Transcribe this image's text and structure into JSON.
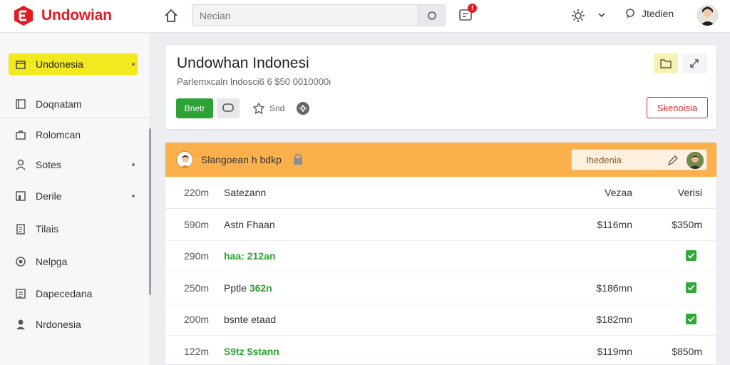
{
  "header": {
    "brand": "Undowian",
    "search_placeholder": "Necian",
    "notification_count": "!",
    "user_name": "Jtedien"
  },
  "sidebar": {
    "items": [
      {
        "label": "Undonesia",
        "active": true,
        "has_dot": true
      },
      {
        "label": "Doqnatam"
      },
      {
        "label": "Rolomcan"
      },
      {
        "label": "Sotes",
        "has_dot": true
      },
      {
        "label": "Derile",
        "has_dot": true
      },
      {
        "label": "Tilais"
      },
      {
        "label": "Nelpga"
      },
      {
        "label": "Dapecedana"
      },
      {
        "label": "Nrdonesia"
      }
    ]
  },
  "card": {
    "title": "Undowhan Indonesi",
    "subtitle": "Parlemxcaln lndosci6 6 $50 0010000i",
    "primary_button": "Bnetr",
    "share_label": "Snd",
    "outline_button": "Skenoisia"
  },
  "table": {
    "header_title": "Slangoean h bdkp",
    "header_box_label": "Ihedenia",
    "columns": [
      "220m",
      "Satezann",
      "Vezaa",
      "Verisi"
    ],
    "rows": [
      {
        "c1": "590m",
        "c2": "Astn Fhaan",
        "c3": "$116mn",
        "c4": "$350m"
      },
      {
        "c1": "290m",
        "c2": "haa: 212an",
        "c2_green": true,
        "check": true
      },
      {
        "c1": "250m",
        "c2_prefix": "Pptle ",
        "c2": "362n",
        "c2_green_suffix": true,
        "c3": "$186mn",
        "check": true
      },
      {
        "c1": "200m",
        "c2": "bsnte etaad",
        "c3": "$182mn",
        "check": true
      },
      {
        "c1": "122m",
        "c2": "S9tz $stann",
        "c2_green": true,
        "c3": "$119mn",
        "c4": "$850m"
      }
    ]
  },
  "colors": {
    "brand_red": "#e31b23",
    "active_yellow": "#f2e91e",
    "table_header_orange": "#fbb04c",
    "success_green": "#2ca234"
  }
}
